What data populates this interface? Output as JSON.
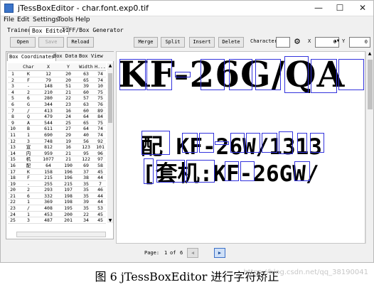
{
  "window": {
    "title": "jTessBoxEditor - char.font.exp0.tif"
  },
  "menu": [
    "File",
    "Edit",
    "Settings",
    "Tools",
    "Help"
  ],
  "main_tabs": [
    "Trainer",
    "Box Editor",
    "TIFF/Box Generator"
  ],
  "toolbar": {
    "open": "Open",
    "save": "Save",
    "reload": "Reload",
    "merge": "Merge",
    "split": "Split",
    "insert": "Insert",
    "delete": "Delete",
    "character_label": "Character",
    "x_label": "X",
    "x_value": "0",
    "y_label": "Y",
    "y_value": "0"
  },
  "panel_tabs": [
    "Box Coordinates",
    "Box Data",
    "Box View"
  ],
  "table": {
    "headers": [
      "",
      "Char",
      "X",
      "Y",
      "Width",
      "H..."
    ],
    "rows": [
      [
        "1",
        "K",
        "12",
        "20",
        "63",
        "74"
      ],
      [
        "2",
        "F",
        "79",
        "20",
        "65",
        "74"
      ],
      [
        "3",
        "-",
        "148",
        "51",
        "39",
        "10"
      ],
      [
        "4",
        "2",
        "210",
        "21",
        "60",
        "75"
      ],
      [
        "5",
        "6",
        "280",
        "22",
        "57",
        "75"
      ],
      [
        "6",
        "G",
        "344",
        "23",
        "63",
        "76"
      ],
      [
        "7",
        "/",
        "413",
        "16",
        "60",
        "89"
      ],
      [
        "8",
        "Q",
        "479",
        "24",
        "64",
        "84"
      ],
      [
        "9",
        "A",
        "544",
        "25",
        "65",
        "75"
      ],
      [
        "10",
        "B",
        "611",
        "27",
        "64",
        "74"
      ],
      [
        "11",
        "1",
        "690",
        "29",
        "40",
        "74"
      ],
      [
        "12",
        "3",
        "748",
        "19",
        "56",
        "92"
      ],
      [
        "13",
        "宣",
        "812",
        "16",
        "123",
        "101"
      ],
      [
        "14",
        "内",
        "959",
        "21",
        "95",
        "96"
      ],
      [
        "15",
        "机",
        "1077",
        "21",
        "122",
        "97"
      ],
      [
        "16",
        "配",
        "64",
        "190",
        "69",
        "58"
      ],
      [
        "17",
        "K",
        "158",
        "196",
        "37",
        "45"
      ],
      [
        "18",
        "F",
        "215",
        "196",
        "38",
        "44"
      ],
      [
        "19",
        "-",
        "255",
        "215",
        "35",
        "7"
      ],
      [
        "20",
        "2",
        "293",
        "197",
        "35",
        "46"
      ],
      [
        "21",
        "6",
        "332",
        "198",
        "35",
        "44"
      ],
      [
        "22",
        "1",
        "369",
        "198",
        "39",
        "44"
      ],
      [
        "23",
        "/",
        "408",
        "195",
        "35",
        "53"
      ],
      [
        "24",
        "1",
        "453",
        "200",
        "22",
        "45"
      ],
      [
        "25",
        "3",
        "487",
        "201",
        "34",
        "45"
      ]
    ]
  },
  "canvas": {
    "line1": "KF-26G/QA",
    "line2": "配 KF-26W/1313",
    "line3": "[套机:KF-26GW/"
  },
  "pager": {
    "label": "Page:",
    "current": "1",
    "of_text": "of",
    "total": "6"
  },
  "caption": {
    "text": "图 6    jTessBoxEditor 进行字符矫正"
  },
  "watermark": {
    "text": "https://blog.csdn.net/qq_38190041"
  }
}
